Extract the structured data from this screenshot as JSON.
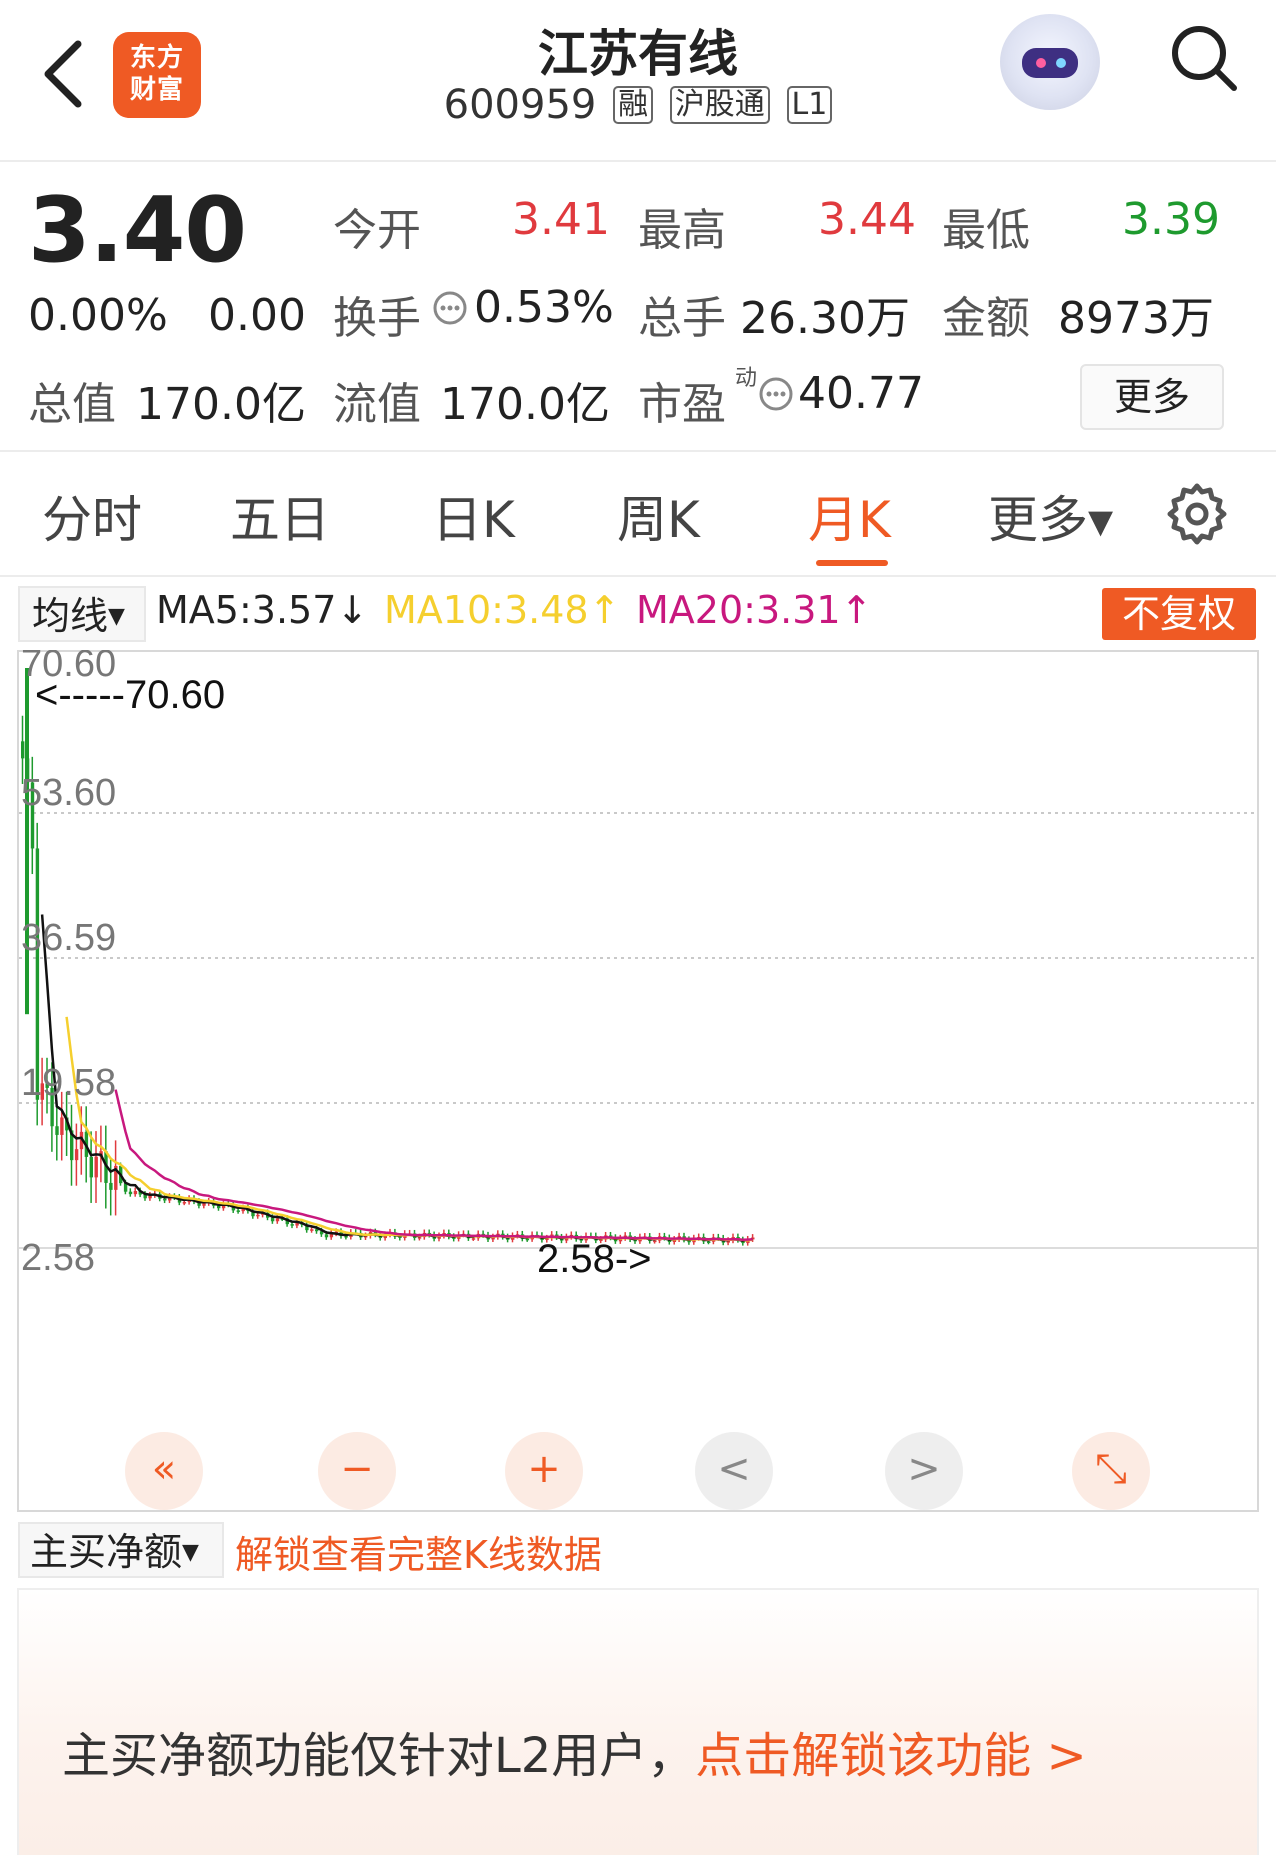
{
  "header": {
    "logo_line1": "东方",
    "logo_line2": "财富",
    "title": "江苏有线",
    "code": "600959",
    "tags": [
      "融",
      "沪股通",
      "L1"
    ]
  },
  "quote": {
    "price": "3.40",
    "change_pct": "0.00%",
    "change": "0.00",
    "open_label": "今开",
    "open": "3.41",
    "high_label": "最高",
    "high": "3.44",
    "low_label": "最低",
    "low": "3.39",
    "turnover_label": "换手",
    "turnover": "0.53%",
    "volume_label": "总手",
    "volume": "26.30万",
    "amount_label": "金额",
    "amount": "8973万",
    "mktcap_label": "总值",
    "mktcap": "170.0亿",
    "float_label": "流值",
    "float": "170.0亿",
    "pe_label": "市盈",
    "pe_sup": "动",
    "pe": "40.77",
    "more_label": "更多"
  },
  "tabs": [
    "分时",
    "五日",
    "日K",
    "周K",
    "月K",
    "更多▾"
  ],
  "active_tab": "月K",
  "ma_bar": {
    "selector": "均线",
    "ma5": "MA5:3.57↓",
    "ma10": "MA10:3.48↑",
    "ma20": "MA20:3.31↑",
    "adjust": "不复权"
  },
  "colors": {
    "accent": "#ef5a24",
    "up": "#e03a3e",
    "down": "#1e9a2e",
    "ma5": "#111111",
    "ma10": "#f5cf2e",
    "ma20": "#c8187e"
  },
  "chart_data": {
    "type": "candlestick",
    "y_ticks": [
      "70.60",
      "53.60",
      "36.59",
      "19.58",
      "2.58"
    ],
    "ylim": [
      2.58,
      70.6
    ],
    "max_marker": "<-----70.60",
    "min_marker": "2.58->",
    "grid": true
  },
  "chart_controls": [
    "«",
    "−",
    "+",
    "<",
    ">",
    "⤡"
  ],
  "bottom": {
    "selector": "主买净额",
    "unlock_link": "解锁查看完整K线数据",
    "l2_text": "主买净额功能仅针对L2用户，",
    "l2_action": "点击解锁该功能 >"
  }
}
